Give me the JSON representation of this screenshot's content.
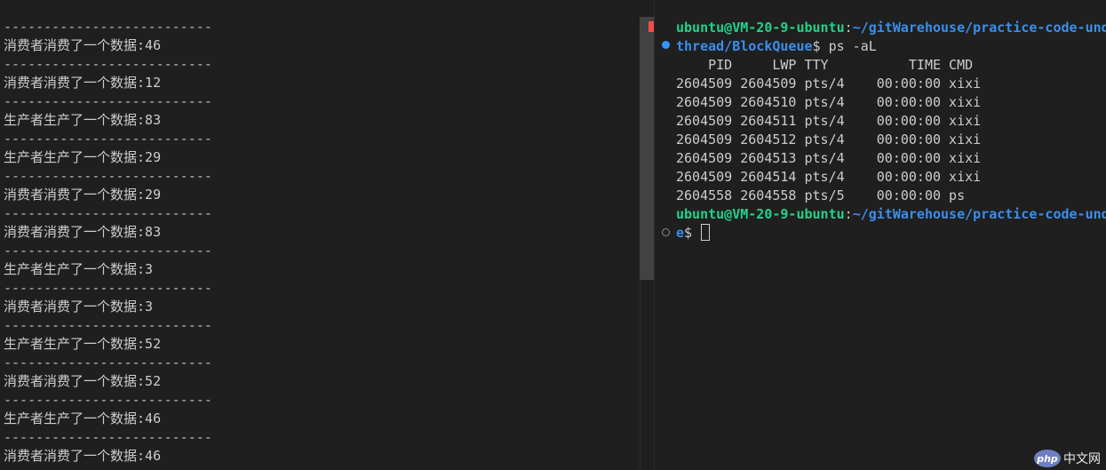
{
  "left_terminal": {
    "lines": [
      {
        "type": "sep",
        "text": "--------------------------"
      },
      {
        "type": "out",
        "text": "消费者消费了一个数据:46"
      },
      {
        "type": "sep",
        "text": "--------------------------"
      },
      {
        "type": "out",
        "text": "消费者消费了一个数据:12"
      },
      {
        "type": "sep",
        "text": "--------------------------"
      },
      {
        "type": "out",
        "text": "生产者生产了一个数据:83"
      },
      {
        "type": "sep",
        "text": "--------------------------"
      },
      {
        "type": "out",
        "text": "生产者生产了一个数据:29"
      },
      {
        "type": "sep",
        "text": "--------------------------"
      },
      {
        "type": "out",
        "text": "消费者消费了一个数据:29"
      },
      {
        "type": "sep",
        "text": "--------------------------"
      },
      {
        "type": "out",
        "text": "消费者消费了一个数据:83"
      },
      {
        "type": "sep",
        "text": "--------------------------"
      },
      {
        "type": "out",
        "text": "生产者生产了一个数据:3"
      },
      {
        "type": "sep",
        "text": "--------------------------"
      },
      {
        "type": "out",
        "text": "消费者消费了一个数据:3"
      },
      {
        "type": "sep",
        "text": "--------------------------"
      },
      {
        "type": "out",
        "text": "生产者生产了一个数据:52"
      },
      {
        "type": "sep",
        "text": "--------------------------"
      },
      {
        "type": "out",
        "text": "消费者消费了一个数据:52"
      },
      {
        "type": "sep",
        "text": "--------------------------"
      },
      {
        "type": "out",
        "text": "生产者生产了一个数据:46"
      },
      {
        "type": "sep",
        "text": "--------------------------"
      },
      {
        "type": "out",
        "text": "消费者消费了一个数据:46"
      }
    ]
  },
  "right_terminal": {
    "prompt1": {
      "user": "ubuntu@VM-20-9-ubuntu",
      "colon": ":",
      "path_line1": "~/gitWarehouse/practice-code-und",
      "path_line2": "thread/BlockQueue",
      "dollar": "$ ",
      "command": "ps -aL"
    },
    "ps_header": "    PID     LWP TTY          TIME CMD",
    "ps_rows": [
      "2604509 2604509 pts/4    00:00:00 xixi",
      "2604509 2604510 pts/4    00:00:00 xixi",
      "2604509 2604511 pts/4    00:00:00 xixi",
      "2604509 2604512 pts/4    00:00:00 xixi",
      "2604509 2604513 pts/4    00:00:00 xixi",
      "2604509 2604514 pts/4    00:00:00 xixi",
      "2604558 2604558 pts/5    00:00:00 ps"
    ],
    "prompt2": {
      "user": "ubuntu@VM-20-9-ubuntu",
      "colon": ":",
      "path_line1": "~/gitWarehouse/practice-code-und",
      "path_line2": "e",
      "dollar": "$ "
    }
  },
  "watermark": {
    "logo_text": "php",
    "site_text": "中文网"
  },
  "colors": {
    "background": "#1f1f1f",
    "text": "#cccccc",
    "prompt_user": "#23d18b",
    "prompt_path": "#3b8eea",
    "error_marker": "#f14c4c",
    "decoration_blue": "#3794ff"
  }
}
